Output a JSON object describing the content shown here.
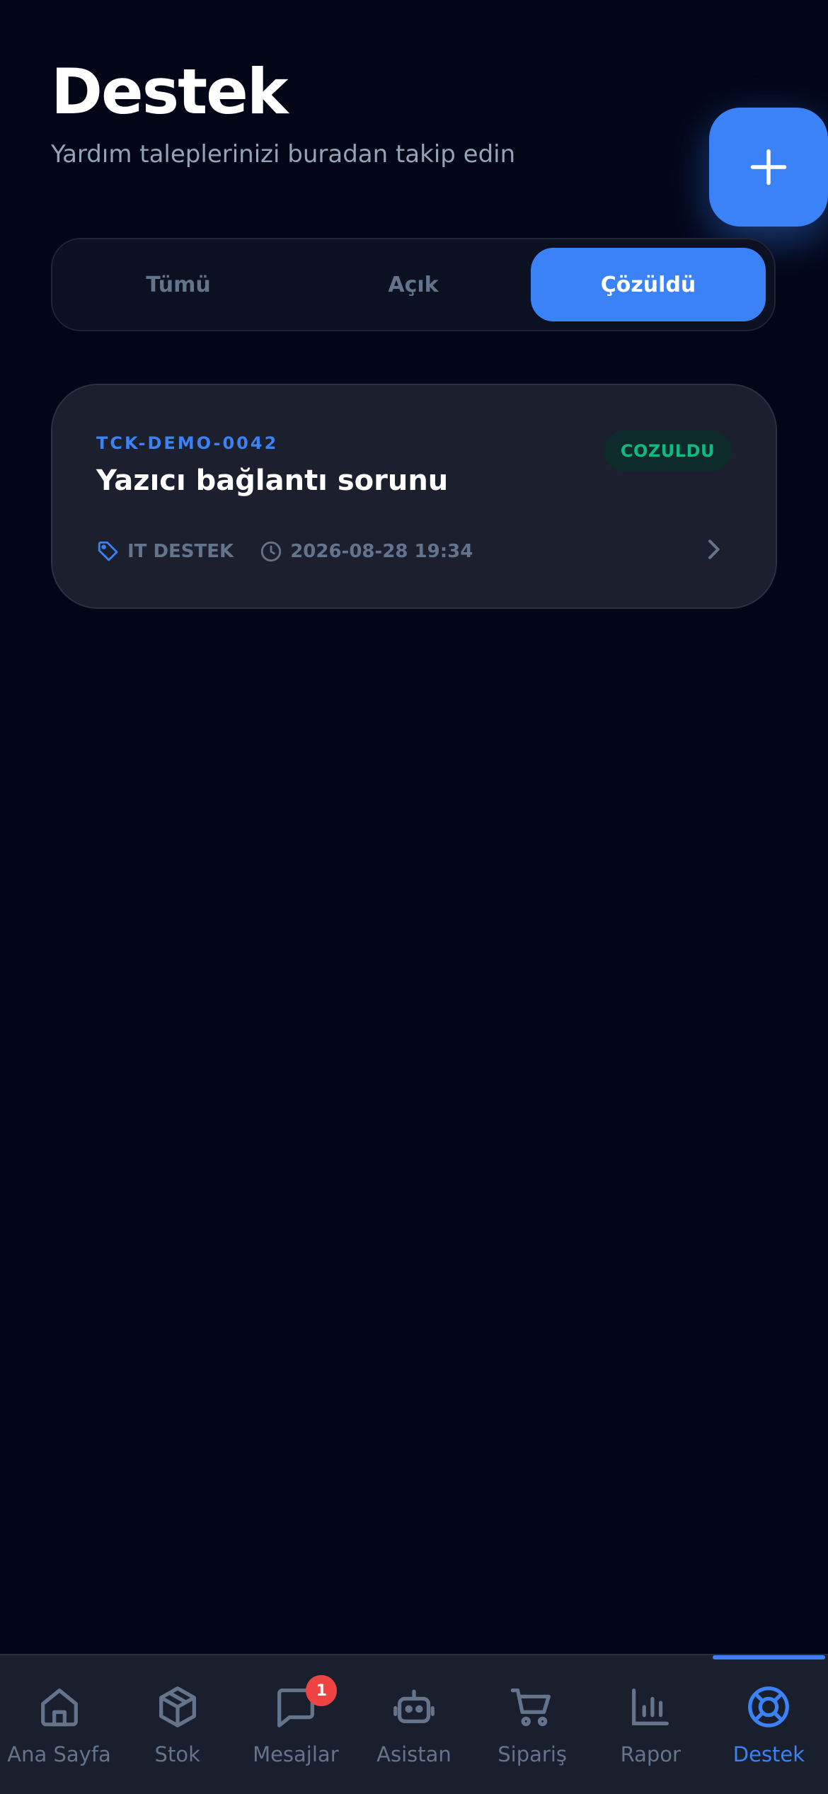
{
  "header": {
    "title": "Destek",
    "subtitle": "Yardım taleplerinizi buradan takip edin"
  },
  "filters": {
    "tabs": [
      {
        "label": "Tümü",
        "active": false
      },
      {
        "label": "Açık",
        "active": false
      },
      {
        "label": "Çözüldü",
        "active": true
      }
    ]
  },
  "tickets": [
    {
      "id": "TCK-DEMO-0042",
      "title": "Yazıcı bağlantı sorunu",
      "status": "COZULDU",
      "category": "IT DESTEK",
      "datetime": "2026-08-28 19:34"
    }
  ],
  "nav": {
    "items": [
      {
        "label": "Ana Sayfa",
        "icon": "home-icon"
      },
      {
        "label": "Stok",
        "icon": "box-icon"
      },
      {
        "label": "Mesajlar",
        "icon": "message-icon",
        "badge": "1"
      },
      {
        "label": "Asistan",
        "icon": "robot-icon"
      },
      {
        "label": "Sipariş",
        "icon": "cart-icon"
      },
      {
        "label": "Rapor",
        "icon": "bar-chart-icon"
      },
      {
        "label": "Destek",
        "icon": "lifebuoy-icon",
        "active": true
      }
    ]
  },
  "colors": {
    "background": "#020617",
    "accent": "#3b82f6",
    "success": "#10b981",
    "badge": "#ef4444",
    "muted": "#64748b"
  }
}
